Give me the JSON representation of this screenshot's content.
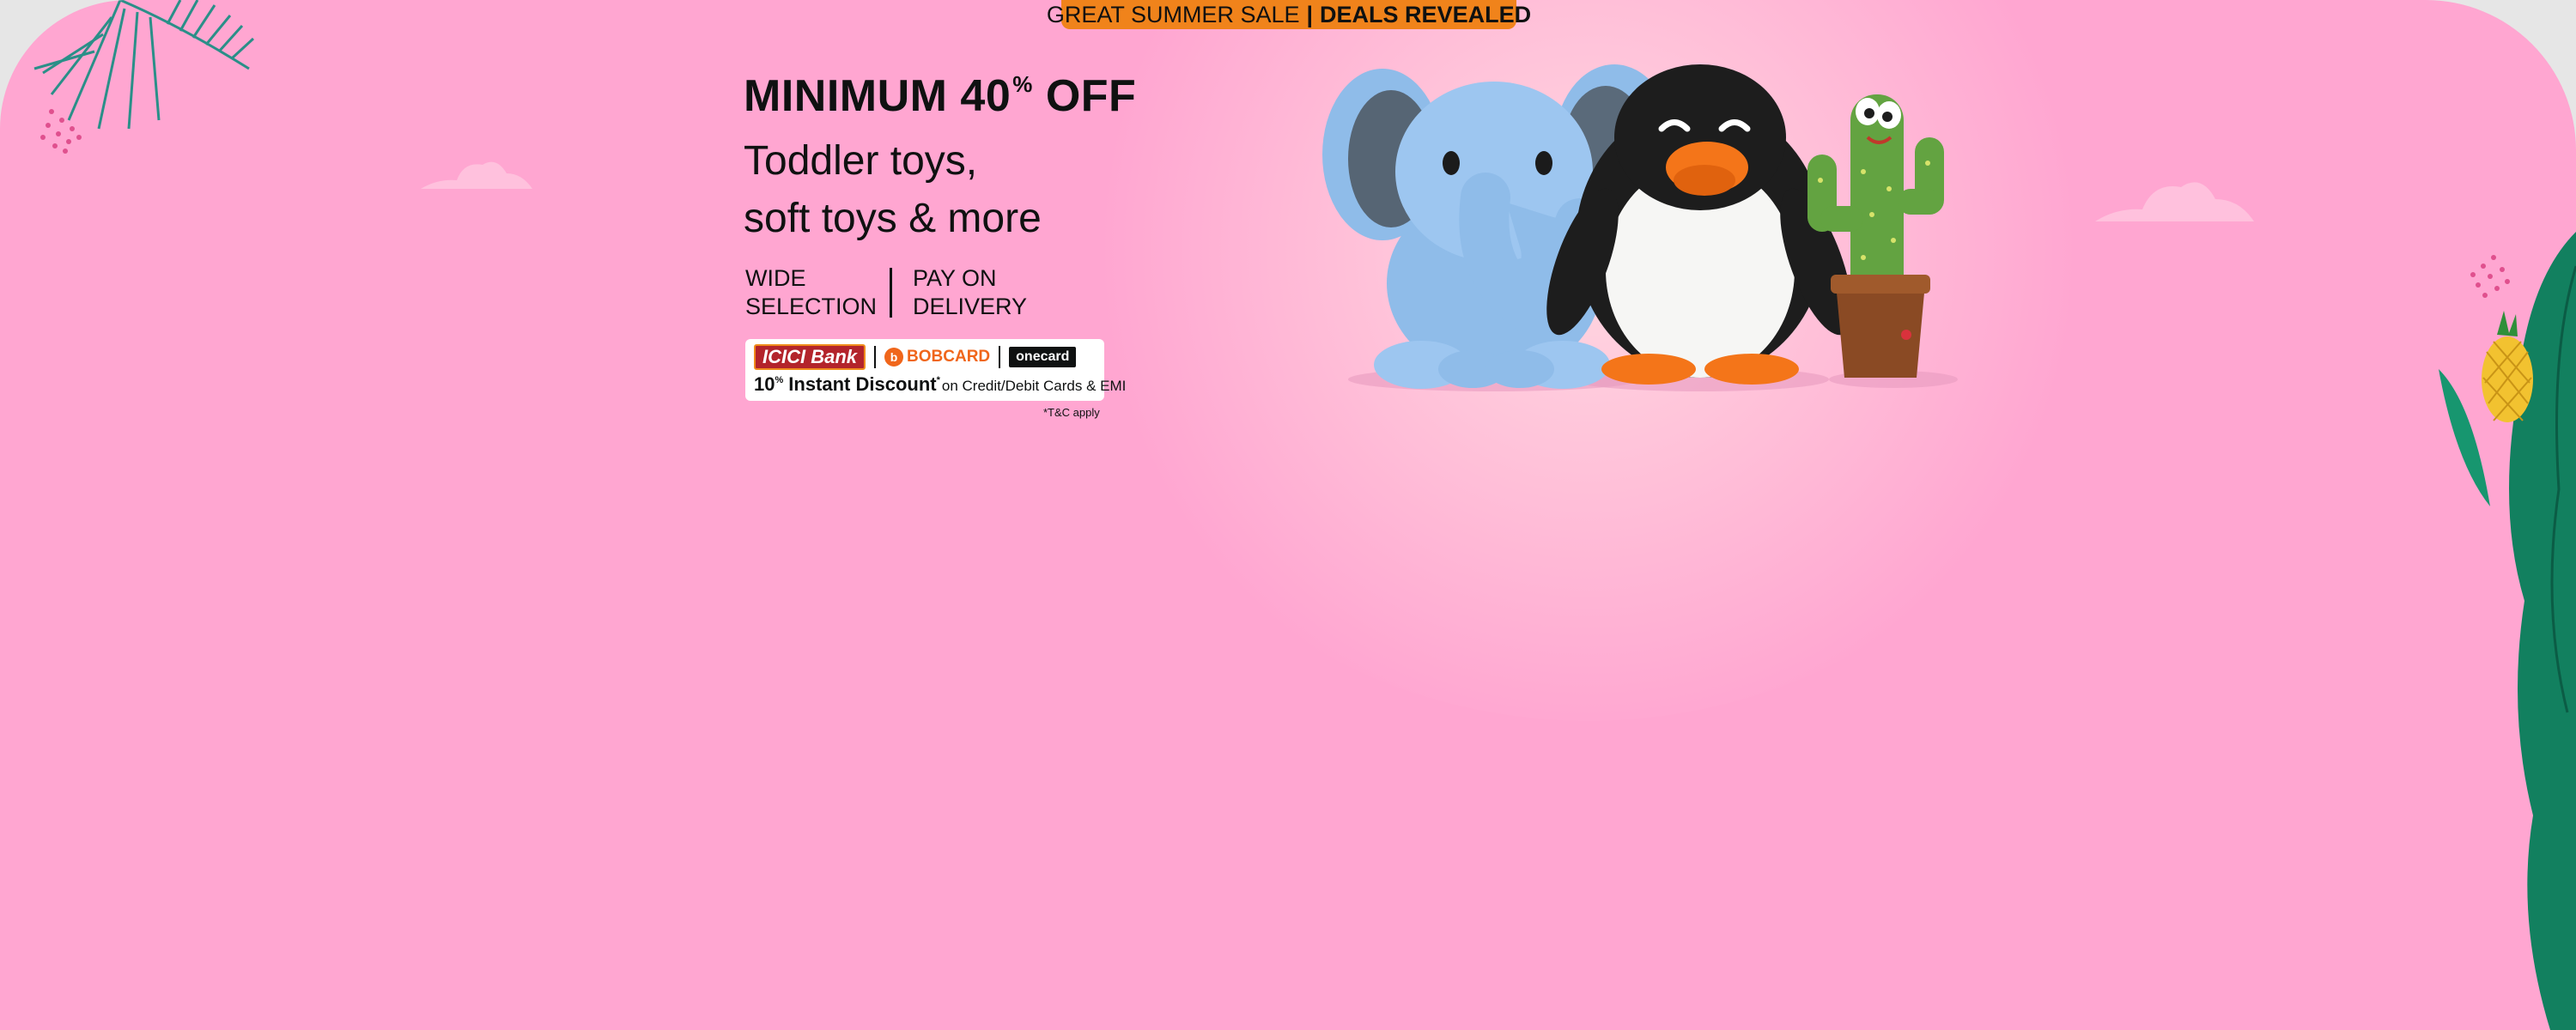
{
  "sale_tag": {
    "left_text": "GREAT SUMMER SALE",
    "separator": "|",
    "right_text": "DEALS REVEALED"
  },
  "headline": {
    "main": "MINIMUM 40",
    "superscript": "%",
    "suffix": "OFF"
  },
  "subheadline": {
    "line1": "Toddler toys,",
    "line2": "soft toys & more"
  },
  "features": [
    {
      "label": "WIDE\nSELECTION"
    },
    {
      "label": "PAY ON\nDELIVERY"
    }
  ],
  "offer": {
    "banks": {
      "icici": "ICICI Bank",
      "bobcard": "BOBCARD",
      "onecard": "onecard"
    },
    "discount_value": "10",
    "discount_superscript": "%",
    "discount_title": "Instant Discount",
    "discount_title_superscript": "*",
    "discount_detail": "on Credit/Debit Cards & EMI"
  },
  "terms": "*T&C apply",
  "products": {
    "items": [
      "elephant-plush",
      "penguin-plush",
      "dancing-cactus-toy"
    ]
  },
  "colors": {
    "banner_background": "#ffa6d1",
    "page_background": "#e6e6e6",
    "sale_tag": "#f0831b",
    "text": "#0f1111",
    "leaf_green": "#12805f"
  }
}
